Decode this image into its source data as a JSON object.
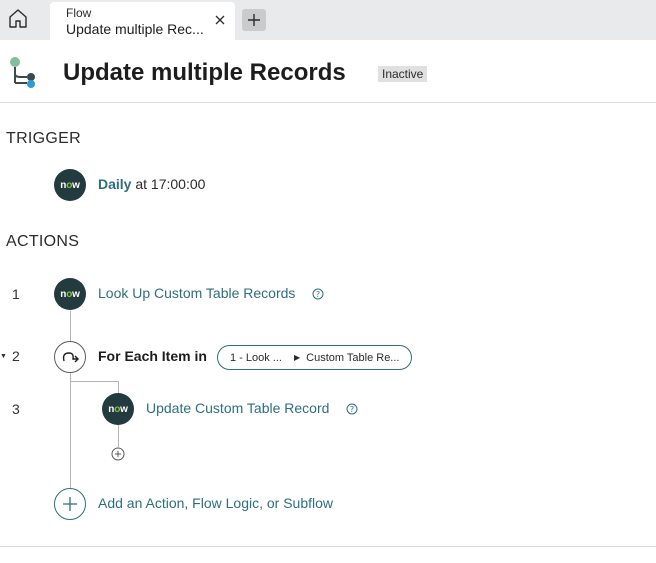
{
  "tab": {
    "title": "Flow",
    "subtitle": "Update multiple Rec...",
    "home_icon": "home-icon",
    "close_icon": "close-icon",
    "add_icon": "plus-icon"
  },
  "header": {
    "title": "Update multiple Records",
    "status": "Inactive",
    "icon": "flow-diagram-icon"
  },
  "trigger": {
    "section_label": "TRIGGER",
    "logo_text_prefix": "n",
    "logo_text_o": "o",
    "logo_text_suffix": "w",
    "label_bold": "Daily",
    "label_rest": " at 17:00:00"
  },
  "actions": {
    "section_label": "ACTIONS",
    "steps": [
      {
        "number": "1",
        "label": "Look Up Custom Table Records",
        "icon": "help-icon"
      },
      {
        "number": "2",
        "label": "For Each Item in",
        "pill_left": "1 - Look ...",
        "pill_right": "Custom Table Re...",
        "icon": "loop-icon"
      },
      {
        "number": "3",
        "label": "Update Custom Table Record",
        "icon": "help-icon"
      }
    ],
    "add_label": "Add an Action, Flow Logic, or Subflow"
  },
  "colors": {
    "accent": "#2e6e7e",
    "logo_bg": "#233a3e",
    "logo_o": "#81c83f",
    "badge_bg": "#e0e0e0"
  }
}
